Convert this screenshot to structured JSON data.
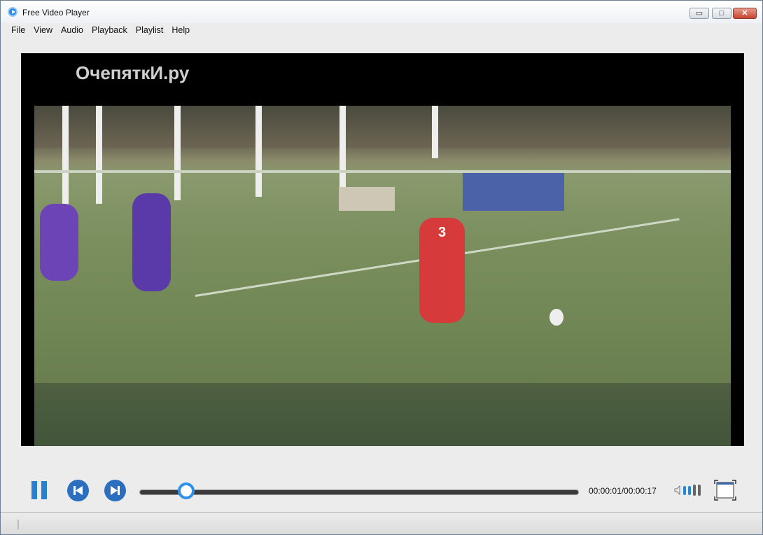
{
  "window": {
    "title": "Free Video Player",
    "minimize": "▭",
    "maximize": "□",
    "close": "✕"
  },
  "menu": [
    "File",
    "View",
    "Audio",
    "Playback",
    "Playlist",
    "Help"
  ],
  "video": {
    "watermark": "ОчепяткИ.ру",
    "jersey_number": "3"
  },
  "controls": {
    "state": "playing",
    "time": "00:00:01/00:00:17",
    "progress_fraction": 0.107,
    "volume_level": 2,
    "volume_max": 4,
    "accent": "#2f92e8"
  }
}
